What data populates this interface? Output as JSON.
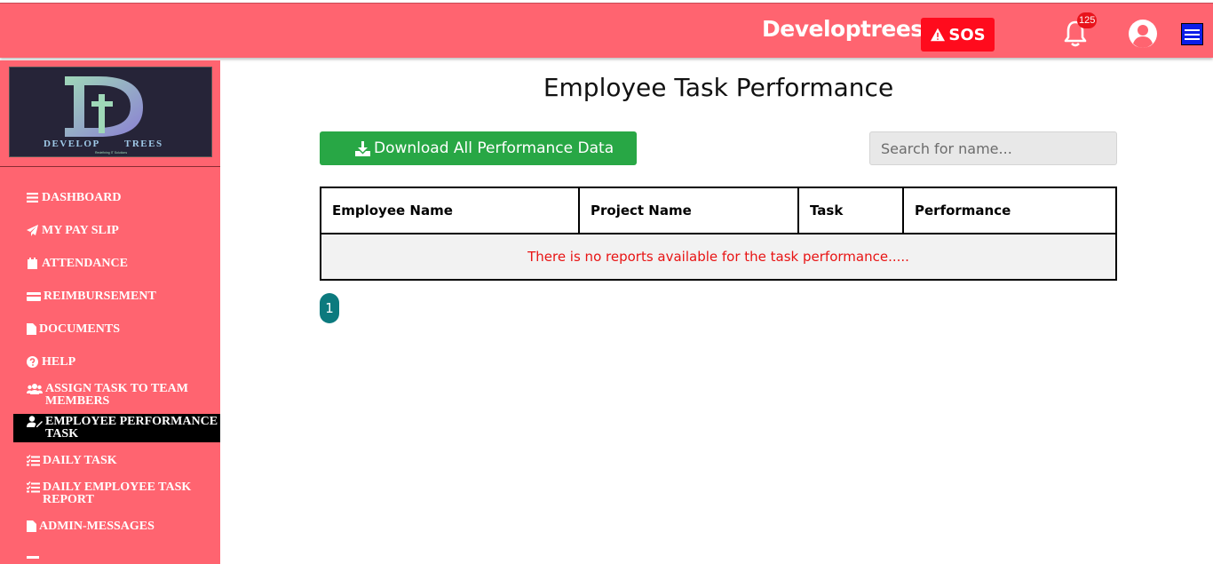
{
  "header": {
    "brand": "Developtrees",
    "sos_label": "SOS",
    "notification_count": "125"
  },
  "sidebar": {
    "logo": {
      "wordmark": "DEVELOP",
      "wordmark2": "TREES",
      "tagline": "Redefining IT Solutions"
    },
    "items": [
      {
        "label": "DASHBOARD",
        "icon": "bars-icon"
      },
      {
        "label": "MY PAY SLIP",
        "icon": "paper-plane-icon"
      },
      {
        "label": "ATTENDANCE",
        "icon": "calendar-icon"
      },
      {
        "label": "REIMBURSEMENT",
        "icon": "credit-card-icon"
      },
      {
        "label": "DOCUMENTS",
        "icon": "file-icon"
      },
      {
        "label": "HELP",
        "icon": "question-circle-icon"
      },
      {
        "label": "ASSIGN TASK TO TEAM MEMBERS",
        "icon": "users-icon"
      },
      {
        "label": "EMPLOYEE PERFORMANCE TASK",
        "icon": "user-edit-icon",
        "active": true
      },
      {
        "label": "DAILY TASK",
        "icon": "list-check-icon"
      },
      {
        "label": "DAILY EMPLOYEE TASK REPORT",
        "icon": "list-check-icon"
      },
      {
        "label": "ADMIN-MESSAGES",
        "icon": "file-icon"
      }
    ]
  },
  "main": {
    "title": "Employee Task Performance",
    "download_label": "Download All Performance Data",
    "search_placeholder": "Search for name...",
    "table": {
      "columns": [
        "Employee Name",
        "Project Name",
        "Task",
        "Performance"
      ],
      "empty_message": "There is no reports available for the task performance....."
    },
    "pagination": {
      "current_page": "1"
    }
  },
  "colors": {
    "brand": "#ff6470",
    "sos": "#ff0b1d",
    "download": "#28a745",
    "page_button": "#0c7a7e",
    "empty_message": "#e81414"
  }
}
